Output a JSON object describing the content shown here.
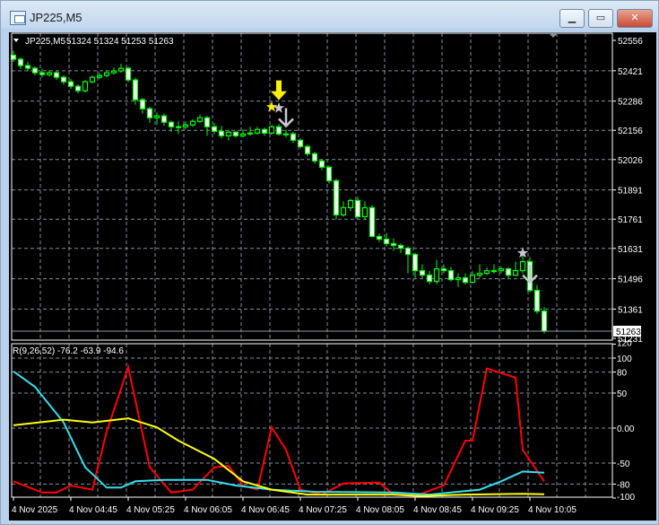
{
  "window": {
    "title": "JP225,M5",
    "buttons": [
      "minimize",
      "maximize",
      "close"
    ]
  },
  "chart_header": {
    "symbol": "JP225,M5",
    "ohlc": "51324 51324 51253 51263"
  },
  "colors": {
    "background": "#000000",
    "candle_outline": "#00ff00",
    "bear_fill": "#ffffff",
    "bull_fill": "#000000",
    "grid": "#8090a0",
    "red_line": "#ff0000",
    "cyan_line": "#33e0f0",
    "yellow_line": "#ffff00",
    "signal_yellow": "#ffee00",
    "signal_gray": "#c8c8d0"
  },
  "price_axis": {
    "ticks": [
      "52556",
      "52421",
      "52286",
      "52156",
      "52026",
      "51891",
      "51761",
      "51631",
      "51496",
      "51361",
      "51231"
    ],
    "current_price": "51263"
  },
  "indicator": {
    "label": "R(9,26,52) -76.2 -63.9 -94.6",
    "ticks": [
      "120",
      "100",
      "80",
      "50",
      "0.00",
      "-50",
      "-80",
      "-100"
    ]
  },
  "time_axis": {
    "labels": [
      "4 Nov 2025",
      "4 Nov 04:45",
      "4 Nov 05:25",
      "4 Nov 06:05",
      "4 Nov 06:45",
      "4 Nov 07:25",
      "4 Nov 08:05",
      "4 Nov 08:45",
      "4 Nov 09:25",
      "4 Nov 10:05"
    ]
  },
  "chart_data": [
    {
      "type": "candlestick",
      "ylim": [
        51231,
        52556
      ],
      "open": [
        52490,
        52472,
        52444,
        52432,
        52412,
        52404,
        52412,
        52392,
        52372,
        52352,
        52332,
        52372,
        52392,
        52400,
        52412,
        52420,
        52432,
        52380,
        52292,
        52252,
        52212,
        52220,
        52192,
        52172,
        52172,
        52180,
        52196,
        52212,
        52172,
        52152,
        52132,
        52148,
        52132,
        52140,
        52144,
        52160,
        52144,
        52172,
        52140,
        52140,
        52112,
        52084,
        52052,
        52020,
        51992,
        51932,
        51780,
        51812,
        51844,
        51772,
        51812,
        51684,
        51672,
        51652,
        51644,
        51632,
        51604,
        51532,
        51512,
        51484,
        51540,
        51532,
        51492,
        51500,
        51480,
        51512,
        51520,
        51532,
        51532,
        51540,
        51512,
        51532,
        51572,
        51444,
        51352
      ],
      "high": [
        52510,
        52480,
        52460,
        52440,
        52430,
        52424,
        52420,
        52400,
        52384,
        52360,
        52380,
        52400,
        52412,
        52424,
        52436,
        52452,
        52440,
        52390,
        52300,
        52260,
        52236,
        52230,
        52200,
        52196,
        52196,
        52206,
        52226,
        52220,
        52190,
        52176,
        52156,
        52152,
        52160,
        52172,
        52172,
        52168,
        52180,
        52184,
        52160,
        52150,
        52120,
        52092,
        52060,
        52028,
        52000,
        51940,
        51840,
        51852,
        51860,
        51840,
        51824,
        51696,
        51700,
        51676,
        51652,
        51640,
        51612,
        51560,
        51530,
        51580,
        51560,
        51548,
        51520,
        51520,
        51530,
        51560,
        51546,
        51560,
        51550,
        51548,
        51572,
        51600,
        51592,
        51468,
        51370
      ],
      "low": [
        52460,
        52430,
        52420,
        52400,
        52392,
        52396,
        52380,
        52360,
        52340,
        52320,
        52324,
        52364,
        52384,
        52392,
        52404,
        52412,
        52370,
        52270,
        52230,
        52190,
        52180,
        52176,
        52150,
        52140,
        52160,
        52172,
        52188,
        52132,
        52140,
        52120,
        52112,
        52124,
        52124,
        52132,
        52136,
        52132,
        52136,
        52132,
        52124,
        52100,
        52076,
        52040,
        52008,
        51980,
        51920,
        51760,
        51772,
        51796,
        51764,
        51760,
        51680,
        51660,
        51640,
        51620,
        51610,
        51520,
        51500,
        51500,
        51472,
        51472,
        51520,
        51484,
        51460,
        51470,
        51476,
        51500,
        51512,
        51520,
        51520,
        51500,
        51508,
        51520,
        51436,
        51340,
        51253
      ],
      "close": [
        52472,
        52444,
        52432,
        52412,
        52404,
        52412,
        52392,
        52372,
        52352,
        52332,
        52372,
        52392,
        52400,
        52412,
        52420,
        52432,
        52380,
        52292,
        52252,
        52212,
        52220,
        52192,
        52172,
        52172,
        52180,
        52196,
        52212,
        52172,
        52152,
        52132,
        52148,
        52132,
        52140,
        52144,
        52160,
        52144,
        52172,
        52140,
        52140,
        52112,
        52084,
        52052,
        52020,
        51992,
        51932,
        51780,
        51812,
        51844,
        51772,
        51812,
        51684,
        51672,
        51652,
        51644,
        51632,
        51604,
        51532,
        51512,
        51484,
        51540,
        51532,
        51492,
        51500,
        51480,
        51512,
        51520,
        51532,
        51532,
        51540,
        51512,
        51532,
        51572,
        51444,
        51352,
        51263
      ],
      "signals": [
        {
          "type": "star",
          "color": "yellow",
          "bar": 36,
          "price": 52260
        },
        {
          "type": "arrow-down",
          "color": "yellow",
          "bar": 37,
          "price": 52330
        },
        {
          "type": "star",
          "color": "gray",
          "bar": 37,
          "price": 52255
        },
        {
          "type": "arrow-down",
          "color": "gray",
          "bar": 38,
          "price": 52215
        },
        {
          "type": "star",
          "color": "gray",
          "bar": 71,
          "price": 51610
        },
        {
          "type": "arrow-down",
          "color": "gray",
          "bar": 72,
          "price": 51520
        }
      ]
    },
    {
      "type": "line",
      "ylim": [
        -100,
        120
      ],
      "grid": true,
      "series": [
        {
          "color": "red",
          "points": [
            [
              0,
              -76
            ],
            [
              4,
              -92
            ],
            [
              6,
              -92
            ],
            [
              8,
              -82
            ],
            [
              11,
              -88
            ],
            [
              13,
              -5
            ],
            [
              16,
              87
            ],
            [
              19,
              -56
            ],
            [
              22,
              -92
            ],
            [
              25,
              -88
            ],
            [
              28,
              -56
            ],
            [
              30,
              -54
            ],
            [
              32,
              -82
            ],
            [
              34,
              -88
            ],
            [
              36,
              1
            ],
            [
              38,
              -31
            ],
            [
              40,
              -88
            ],
            [
              43,
              -95
            ],
            [
              46,
              -79
            ],
            [
              51,
              -78
            ],
            [
              53,
              -95
            ],
            [
              56,
              -97
            ],
            [
              60,
              -82
            ],
            [
              63,
              -18
            ],
            [
              64,
              -18
            ],
            [
              66,
              85
            ],
            [
              70,
              72
            ],
            [
              71,
              -31
            ],
            [
              74,
              -76.2
            ]
          ]
        },
        {
          "color": "cyan",
          "points": [
            [
              0,
              81
            ],
            [
              3,
              59
            ],
            [
              7,
              8
            ],
            [
              10,
              -56
            ],
            [
              13,
              -85
            ],
            [
              15,
              -85
            ],
            [
              17,
              -76
            ],
            [
              21,
              -74
            ],
            [
              27,
              -74
            ],
            [
              31,
              -82
            ],
            [
              36,
              -88
            ],
            [
              42,
              -91
            ],
            [
              53,
              -92
            ],
            [
              58,
              -95
            ],
            [
              65,
              -88
            ],
            [
              68,
              -76
            ],
            [
              71,
              -62
            ],
            [
              74,
              -63.9
            ]
          ]
        },
        {
          "color": "yellow",
          "points": [
            [
              0,
              4
            ],
            [
              7,
              12
            ],
            [
              11,
              8
            ],
            [
              16,
              14
            ],
            [
              20,
              1
            ],
            [
              23,
              -18
            ],
            [
              28,
              -44
            ],
            [
              32,
              -76
            ],
            [
              36,
              -88
            ],
            [
              41,
              -95
            ],
            [
              53,
              -95
            ],
            [
              57,
              -97
            ],
            [
              63,
              -95
            ],
            [
              71,
              -94
            ],
            [
              74,
              -94.6
            ]
          ]
        }
      ]
    }
  ]
}
